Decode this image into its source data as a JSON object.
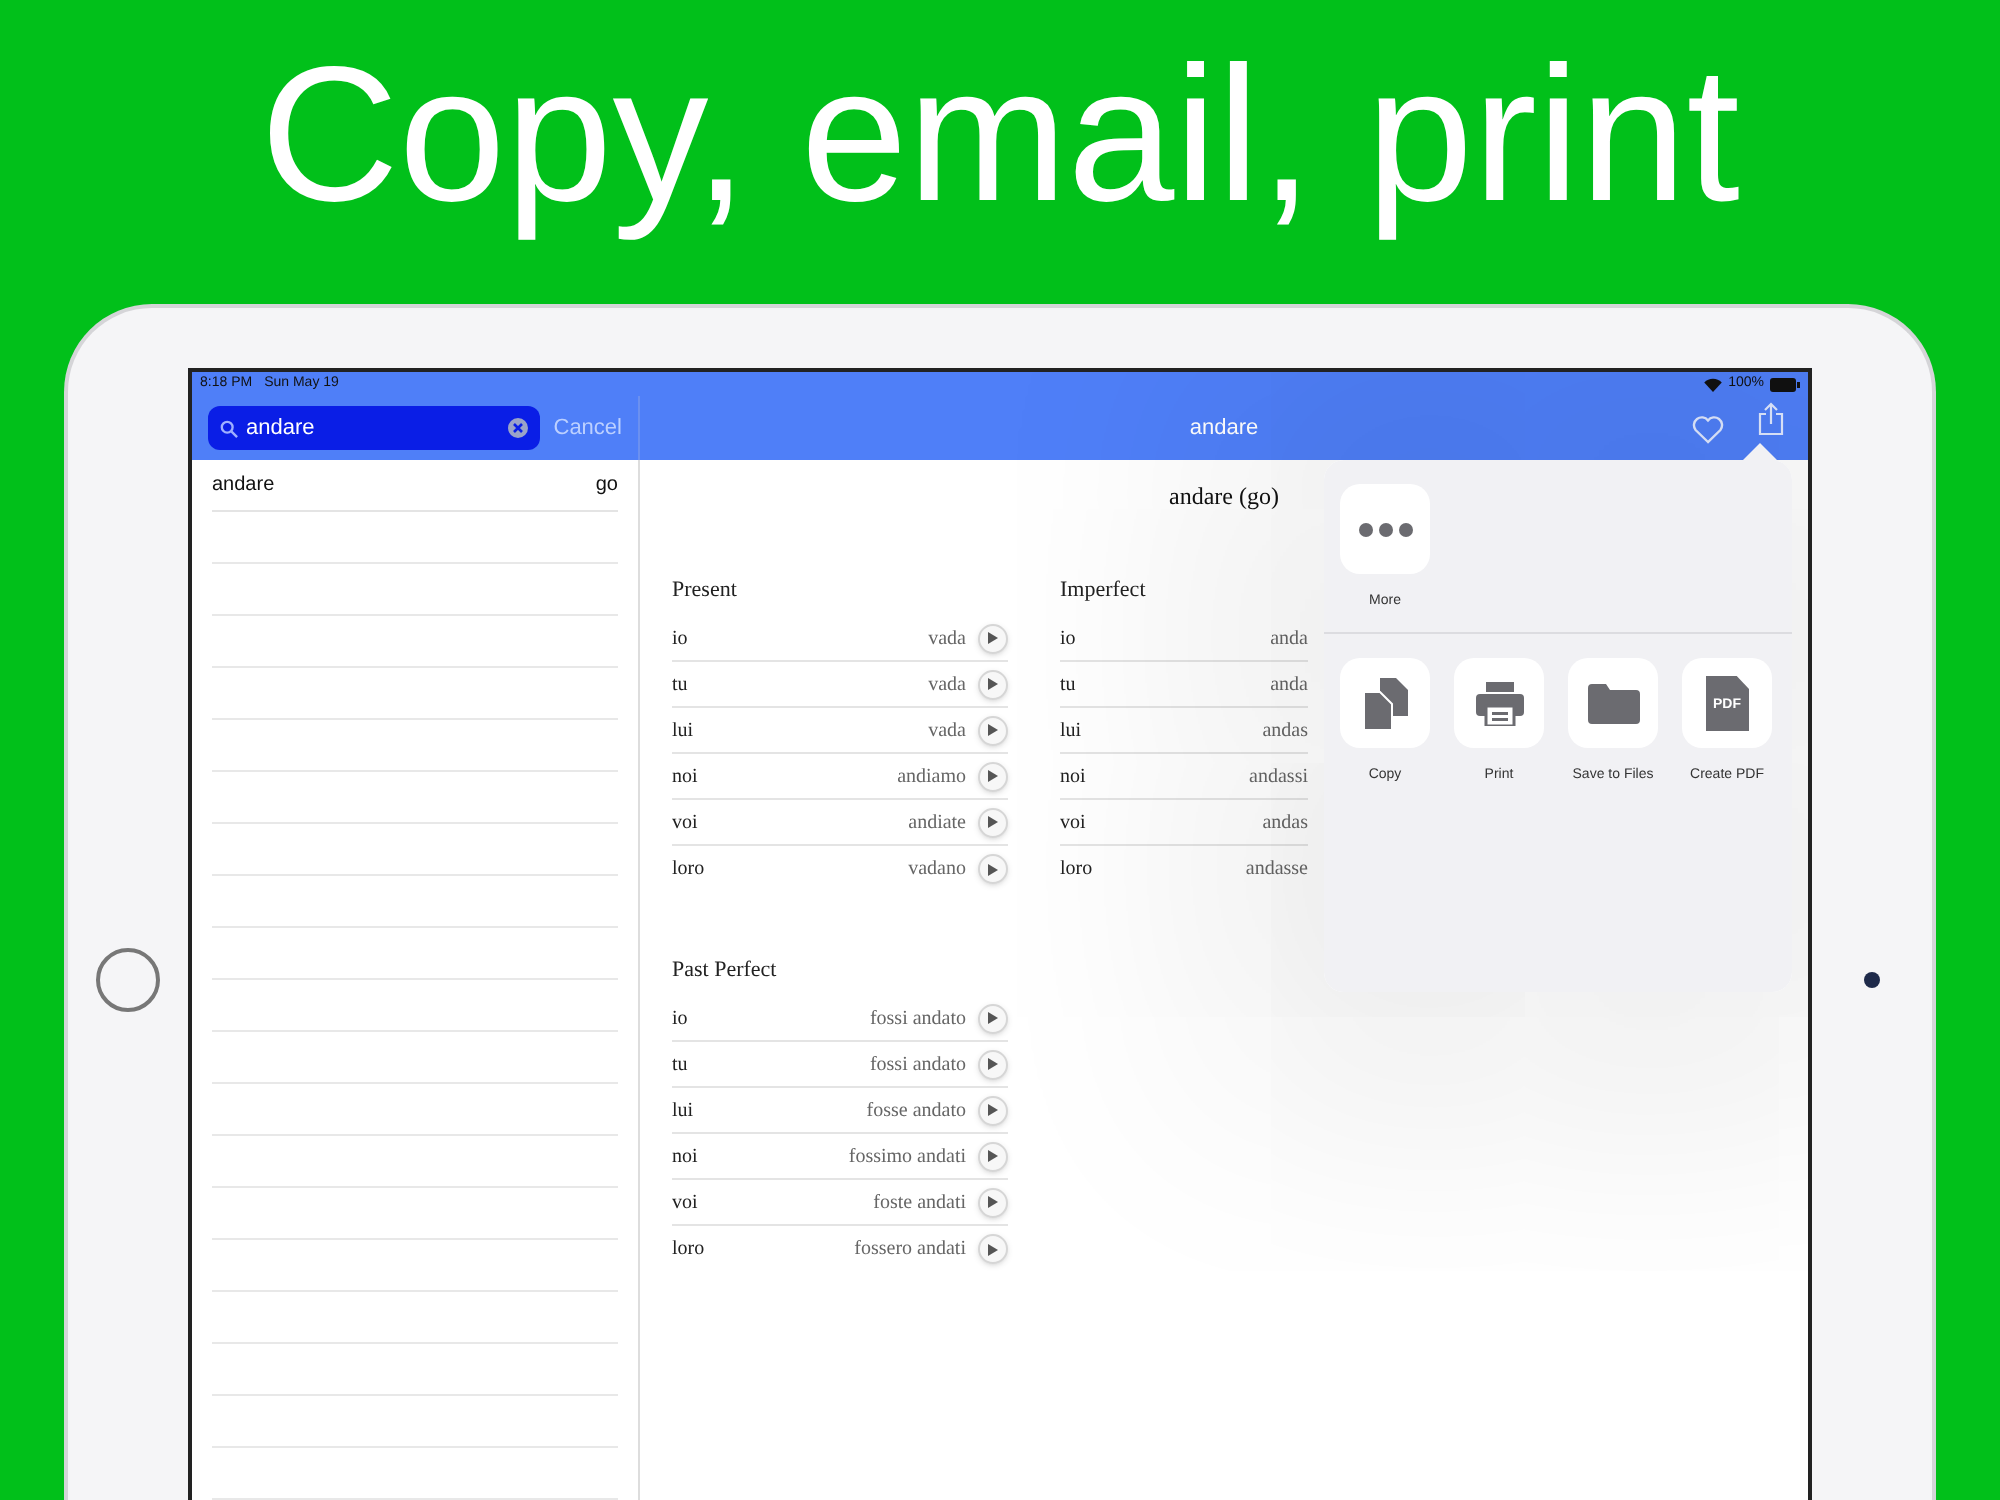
{
  "headline": "Copy, email, print",
  "status_bar": {
    "time": "8:18 PM",
    "date": "Sun May 19",
    "battery": "100%"
  },
  "search": {
    "value": "andare",
    "cancel": "Cancel"
  },
  "results": [
    {
      "word": "andare",
      "translation": "go"
    }
  ],
  "nav": {
    "title": "andare"
  },
  "verb_title": "andare (go)",
  "tenses": [
    {
      "name": "Present",
      "rows": [
        {
          "pronoun": "io",
          "form": "vada"
        },
        {
          "pronoun": "tu",
          "form": "vada"
        },
        {
          "pronoun": "lui",
          "form": "vada"
        },
        {
          "pronoun": "noi",
          "form": "andiamo"
        },
        {
          "pronoun": "voi",
          "form": "andiate"
        },
        {
          "pronoun": "loro",
          "form": "vadano"
        }
      ]
    },
    {
      "name": "Imperfect",
      "rows": [
        {
          "pronoun": "io",
          "form": "anda"
        },
        {
          "pronoun": "tu",
          "form": "anda"
        },
        {
          "pronoun": "lui",
          "form": "andas"
        },
        {
          "pronoun": "noi",
          "form": "andassi"
        },
        {
          "pronoun": "voi",
          "form": "andas"
        },
        {
          "pronoun": "loro",
          "form": "andasse"
        }
      ]
    },
    {
      "name": "Past Perfect",
      "rows": [
        {
          "pronoun": "io",
          "form": "fossi andato"
        },
        {
          "pronoun": "tu",
          "form": "fossi andato"
        },
        {
          "pronoun": "lui",
          "form": "fosse andato"
        },
        {
          "pronoun": "noi",
          "form": "fossimo andati"
        },
        {
          "pronoun": "voi",
          "form": "foste andati"
        },
        {
          "pronoun": "loro",
          "form": "fossero andati"
        }
      ]
    }
  ],
  "share_sheet": {
    "top_actions": [
      {
        "label": "More",
        "kind": "more"
      }
    ],
    "actions": [
      {
        "label": "Copy",
        "kind": "copy"
      },
      {
        "label": "Print",
        "kind": "print"
      },
      {
        "label": "Save to Files",
        "kind": "files"
      },
      {
        "label": "Create PDF",
        "kind": "pdf",
        "badge": "PDF"
      }
    ]
  }
}
